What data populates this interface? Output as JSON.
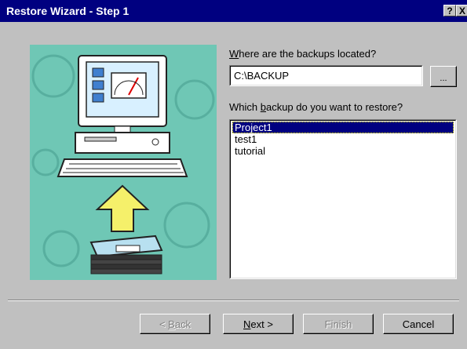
{
  "window": {
    "title": "Restore Wizard - Step 1",
    "help_glyph": "?",
    "close_glyph": "X"
  },
  "location": {
    "label_prefix": "",
    "label_underline": "W",
    "label_rest": "here are the backups located?",
    "value": "C:\\BACKUP",
    "browse_label": "..."
  },
  "backups": {
    "label_prefix": "Which ",
    "label_underline": "b",
    "label_rest": "ackup do you want to restore?",
    "items": [
      "Project1",
      "test1",
      "tutorial"
    ],
    "selected_index": 0
  },
  "buttons": {
    "back_prefix": "< ",
    "back_underline": "B",
    "back_rest": "ack",
    "next_underline": "N",
    "next_rest": "ext >",
    "finish": "Finish",
    "cancel": "Cancel"
  },
  "colors": {
    "titlebar": "#000080",
    "illustration_bg": "#6fc7b5",
    "selection": "#000080"
  },
  "icons": [
    "computer-illustration",
    "arrow-up-icon",
    "floppy-disks-illustration"
  ]
}
